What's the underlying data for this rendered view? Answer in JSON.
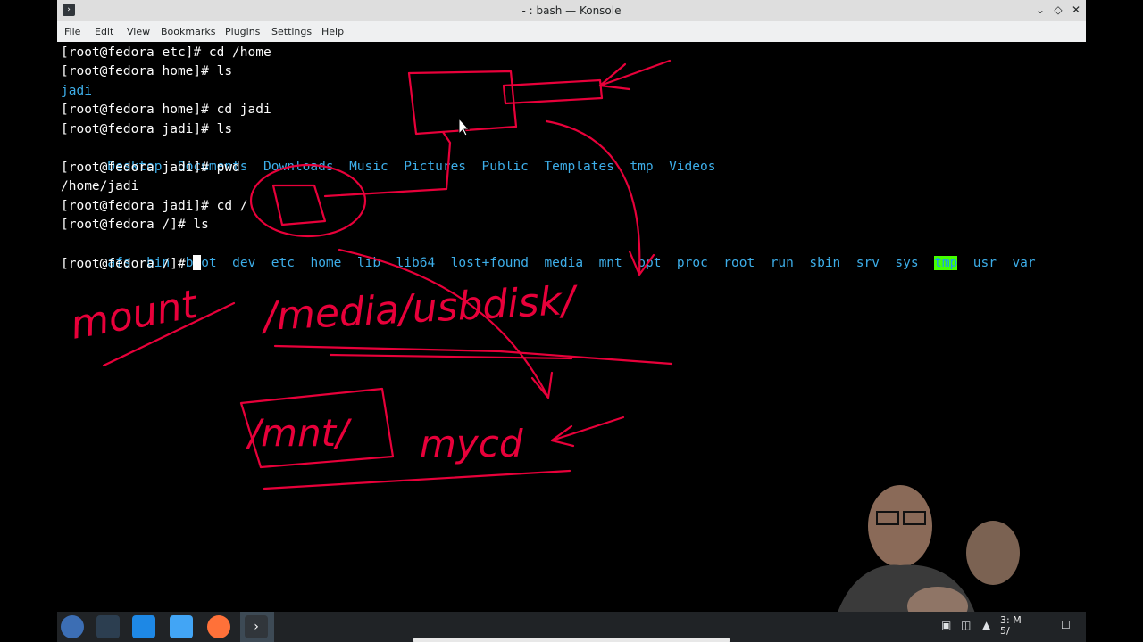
{
  "window": {
    "title": "- : bash — Konsole",
    "buttons": [
      "minimize",
      "maximize",
      "close"
    ]
  },
  "menu": [
    "File",
    "Edit",
    "View",
    "Bookmarks",
    "Plugins",
    "Settings",
    "Help"
  ],
  "terminal": {
    "lines": [
      "[root@fedora etc]# cd /home",
      "[root@fedora home]# ls",
      "jadi",
      "[root@fedora home]# cd jadi",
      "[root@fedora jadi]# ls",
      "",
      "[root@fedora jadi]# pwd",
      "/home/jadi",
      "[root@fedora jadi]# cd /",
      "[root@fedora /]# ls",
      "",
      "[root@fedora /]# "
    ],
    "home_listing": [
      "Desktop",
      "Documents",
      "Downloads",
      "Music",
      "Pictures",
      "Public",
      "Templates",
      "tmp",
      "Videos"
    ],
    "root_listing": [
      "afs",
      "bin",
      "boot",
      "dev",
      "etc",
      "home",
      "lib",
      "lib64",
      "lost+found",
      "media",
      "mnt",
      "opt",
      "proc",
      "root",
      "run",
      "sbin",
      "srv",
      "sys",
      "tmp",
      "usr",
      "var"
    ]
  },
  "annotations": {
    "word_mount": "mount",
    "path_media": "/media/usbdisk/",
    "path_mnt": "/mnt/",
    "word_mycd": "mycd"
  },
  "taskbar": {
    "apps": [
      "fedora-launcher-icon",
      "system-settings-icon",
      "discover-icon",
      "file-manager-icon",
      "firefox-icon",
      "konsole-icon"
    ],
    "clock_time": "3:",
    "clock_suffix": "M",
    "clock_date": "5/"
  },
  "colors": {
    "ink": "#e8003a",
    "directory": "#3daee9",
    "highlight": "#44ff00"
  }
}
